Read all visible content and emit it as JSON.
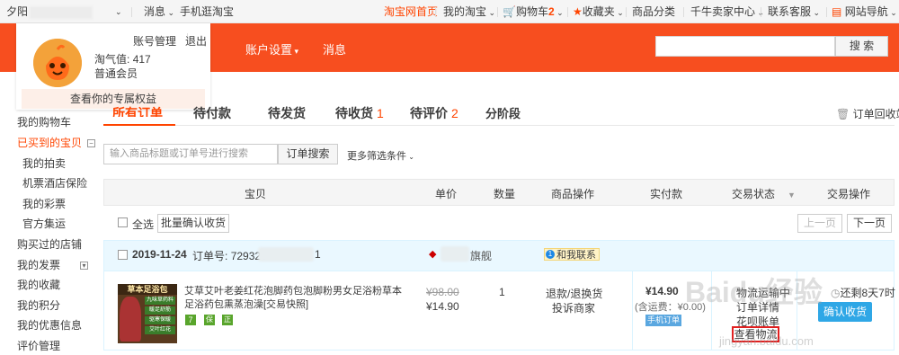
{
  "topbar": {
    "username": "夕阳",
    "messages": "消息",
    "mobile": "手机逛淘宝",
    "home": "淘宝网首页",
    "my_taobao": "我的淘宝",
    "cart": "购物车",
    "cart_count": "2",
    "favorites": "收藏夹",
    "categories": "商品分类",
    "seller_center": "千牛卖家中心",
    "customer_service": "联系客服",
    "site_nav": "网站导航"
  },
  "header": {
    "account_settings": "账户设置",
    "messages": "消息",
    "search_button": "搜 索"
  },
  "user_popup": {
    "account_mgmt": "账号管理",
    "logout": "退出",
    "taoqi_label": "淘气值:",
    "taoqi_value": "417",
    "member_level": "普通会员",
    "benefits": "查看你的专属权益"
  },
  "sidebar": {
    "cart": "我的购物车",
    "bought": "已买到的宝贝",
    "auctions": "我的拍卖",
    "tickets": "机票酒店保险",
    "lottery": "我的彩票",
    "official": "官方集运",
    "shops": "购买过的店铺",
    "invoice": "我的发票",
    "favorites": "我的收藏",
    "points": "我的积分",
    "coupons": "我的优惠信息",
    "reviews": "评价管理"
  },
  "tabs": {
    "all": "所有订单",
    "pending_pay": "待付款",
    "pending_ship": "待发货",
    "pending_receive": "待收货",
    "pending_receive_count": "1",
    "pending_review": "待评价",
    "pending_review_count": "2",
    "installment": "分阶段",
    "recycle": "订单回收站"
  },
  "filter": {
    "search_placeholder": "输入商品标题或订单号进行搜索",
    "search_button": "订单搜索",
    "more_filters": "更多筛选条件"
  },
  "table_headers": {
    "item": "宝贝",
    "price": "单价",
    "qty": "数量",
    "operations": "商品操作",
    "paid": "实付款",
    "status": "交易状态",
    "actions": "交易操作"
  },
  "bulk": {
    "select_all": "全选",
    "batch_confirm": "批量确认收货",
    "prev_page": "上一页",
    "next_page": "下一页"
  },
  "order": {
    "date": "2019-11-24",
    "order_no_label": "订单号:",
    "order_no": "729328",
    "chat": "和我联系",
    "thumb_title": "草本足浴包",
    "thumb_lines": [
      "九味草药料",
      "暖足舒筋",
      "驱寒保暖",
      "艾叶红花"
    ],
    "title": "艾草艾叶老姜红花泡脚药包泡脚粉男女足浴粉草本足浴药包熏蒸泡澡",
    "title_suffix": "[交易快照]",
    "badge_seven": "7",
    "badge_shield": "保",
    "badge_genuine": "正",
    "original_price": "¥98.00",
    "price": "¥14.90",
    "qty": "1",
    "op_refund": "退款/退换货",
    "op_complain": "投诉商家",
    "total": "¥14.90",
    "shipping_note": "(含运费：¥0.00)",
    "mobile_order": "手机订单",
    "status_1": "物流运输中",
    "status_2": "订单详情",
    "status_3": "花呗账单",
    "view_logistics": "查看物流",
    "remaining_time": "还剩8天7时",
    "confirm_receipt": "确认收货"
  },
  "watermark": {
    "main": "Baidu经验",
    "sub": "jingyan.baidu.com"
  }
}
